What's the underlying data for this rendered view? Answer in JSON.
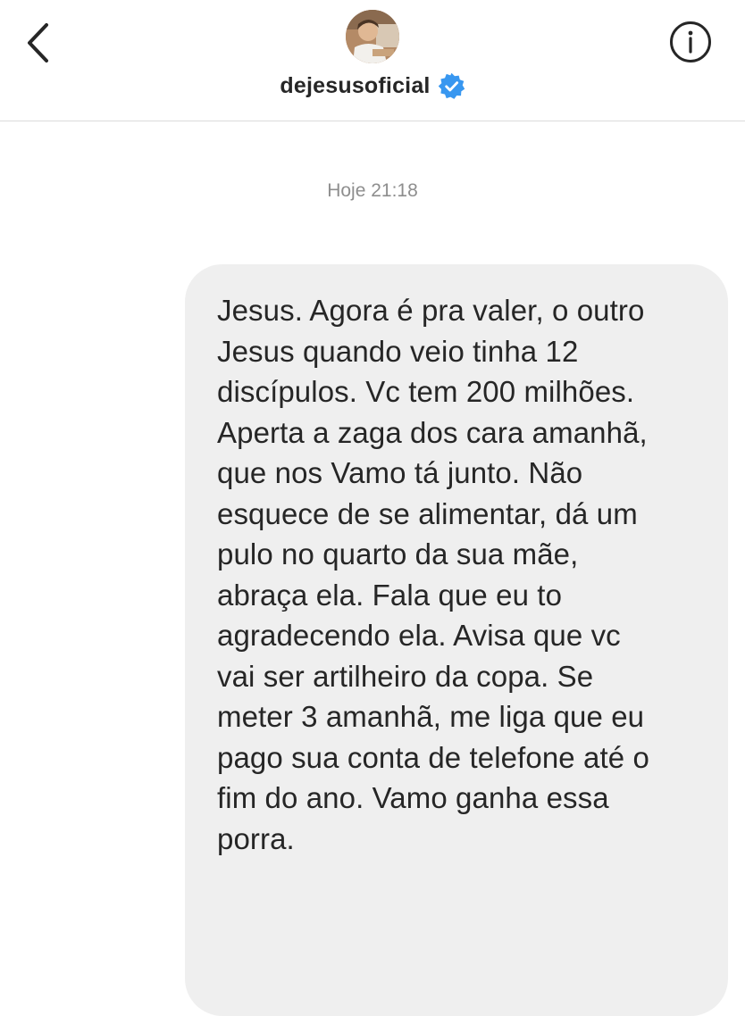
{
  "header": {
    "username": "dejesusoficial",
    "back_icon": "chevron-left-icon",
    "info_icon": "info-circle-icon",
    "verified_icon": "verified-badge-icon"
  },
  "chat": {
    "timestamp": "Hoje 21:18",
    "messages": [
      {
        "text": "Jesus. Agora é pra valer, o outro\nJesus quando veio tinha 12\ndiscípulos. Vc tem 200 milhões.\nAperta a zaga dos cara amanhã,\nque nos Vamo tá junto. Não\nesquece de se alimentar, dá um\npulo no quarto da sua mãe,\nabraça ela. Fala que eu to\nagradecendo ela. Avisa que vc\nvai ser artilheiro da copa. Se\nmeter 3 amanhã, me liga que eu\npago sua conta de telefone até o\nfim do ano. Vamo ganha essa\nporra."
      }
    ]
  },
  "colors": {
    "bubble_bg": "#efefef",
    "text": "#262626",
    "timestamp": "#8e8e8e",
    "verified": "#3897f0",
    "divider": "#dbdbdb"
  }
}
